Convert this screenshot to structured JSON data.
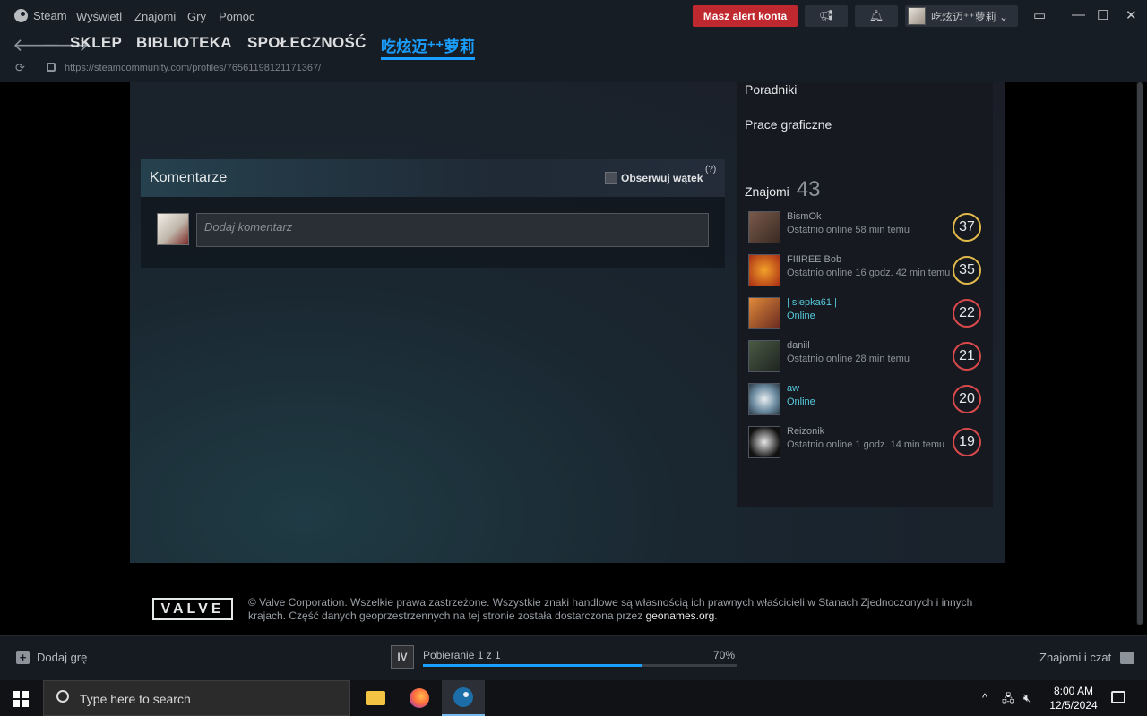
{
  "menubar": {
    "steam": "Steam",
    "items": [
      "Wyświetl",
      "Znajomi",
      "Gry",
      "Pomoc"
    ],
    "alert": "Masz alert konta",
    "username": "吃炫迈⁺⁺萝莉 ⌄"
  },
  "nav": {
    "store": "SKLEP",
    "library": "BIBLIOTEKA",
    "community": "SPOŁECZNOŚĆ",
    "profile": "吃炫迈⁺⁺萝莉"
  },
  "url": "https://steamcommunity.com/profiles/76561198121171367/",
  "sidebar": {
    "links": [
      "Poradniki",
      "Prace graficzne"
    ],
    "friends_label": "Znajomi",
    "friends_count": "43",
    "friends": [
      {
        "name": "BismOk",
        "status": "Ostatnio online 58 min temu",
        "level": "37",
        "online": false
      },
      {
        "name": "FIIIREE Bob",
        "status": "Ostatnio online 16 godz. 42 min temu",
        "level": "35",
        "online": false
      },
      {
        "name": "| slepka61 |",
        "status": "Online",
        "level": "22",
        "online": true
      },
      {
        "name": "daniil",
        "status": "Ostatnio online 28 min temu",
        "level": "21",
        "online": false
      },
      {
        "name": "aw",
        "status": "Online",
        "level": "20",
        "online": true
      },
      {
        "name": "Reizonik",
        "status": "Ostatnio online 1 godz. 14 min temu",
        "level": "19",
        "online": false
      }
    ]
  },
  "comments": {
    "title": "Komentarze",
    "follow": "Obserwuj wątek",
    "help": "(?)",
    "placeholder": "Dodaj komentarz"
  },
  "footer": {
    "logo": "VALVE",
    "text": "© Valve Corporation. Wszelkie prawa zastrzeżone. Wszystkie znaki handlowe są własnością ich prawnych właścicieli w Stanach Zjednoczonych i innych krajach. Część danych geoprzestrzennych na tej stronie została dostarczona przez",
    "link": "geonames.org",
    "end": "."
  },
  "bottombar": {
    "add_game": "Dodaj grę",
    "download_icon_label": "IV",
    "download_label": "Pobieranie 1 z 1",
    "download_pct_label": "70%",
    "download_fraction": 0.7,
    "friends_chat": "Znajomi i czat"
  },
  "taskbar": {
    "search": "Type here to search",
    "time": "8:00 AM",
    "date": "12/5/2024"
  },
  "colors": {
    "accent": "#1a9fff",
    "alert": "#c0282f",
    "online": "#57cbde"
  }
}
